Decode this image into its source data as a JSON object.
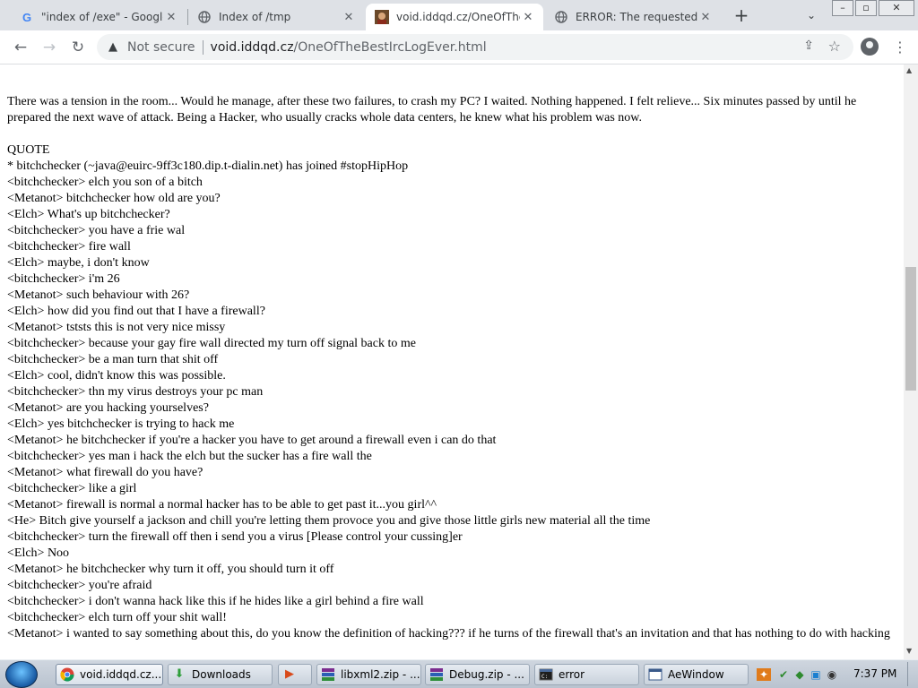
{
  "browser": {
    "tabs": [
      {
        "title": "\"index of /exe\" - Google",
        "icon": "google-g-icon",
        "active": false
      },
      {
        "title": "Index of /tmp",
        "icon": "globe-icon",
        "active": false
      },
      {
        "title": "void.iddqd.cz/OneOfTheB",
        "icon": "site-favicon",
        "active": true
      },
      {
        "title": "ERROR: The requested UR",
        "icon": "globe-icon",
        "active": false
      }
    ],
    "new_tab": "+",
    "tab_menu": "⌄",
    "window_controls": {
      "minimize": "–",
      "maximize": "▫",
      "close": "✕"
    },
    "address": {
      "security": "Not secure",
      "host": "void.iddqd.cz",
      "path": "/OneOfTheBestIrcLogEver.html"
    }
  },
  "page": {
    "intro": "There was a tension in the room... Would he manage, after these two failures, to crash my PC? I waited. Nothing happened. I felt relieve... Six minutes passed by until he prepared the next wave of attack. Being a Hacker, who usually cracks whole data centers, he knew what his problem was now.",
    "quote_label": "QUOTE",
    "chat": [
      "* bitchchecker (~java@euirc-9ff3c180.dip.t-dialin.net) has joined #stopHipHop",
      "<bitchchecker> elch you son of a bitch",
      "<Metanot> bitchchecker how old are you?",
      "<Elch> What's up bitchchecker?",
      "<bitchchecker> you have a frie wal",
      "<bitchchecker> fire wall",
      "<Elch> maybe, i don't know",
      "<bitchchecker> i'm 26",
      "<Metanot> such behaviour with 26?",
      "<Elch> how did you find out that I have a firewall?",
      "<Metanot> tststs this is not very nice missy",
      "<bitchchecker> because your gay fire wall directed my turn off signal back to me",
      "<bitchchecker> be a man turn that shit off",
      "<Elch> cool, didn't know this was possible.",
      "<bitchchecker> thn my virus destroys your pc man",
      "<Metanot> are you hacking yourselves?",
      "<Elch> yes bitchchecker is trying to hack me",
      "<Metanot> he bitchchecker if you're a hacker you have to get around a firewall even i can do that",
      "<bitchchecker> yes man i hack the elch but the sucker has a fire wall the",
      "<Metanot> what firewall do you have?",
      "<bitchchecker> like a girl",
      "<Metanot> firewall is normal a normal hacker has to be able to get past it...you girl^^",
      "<He> Bitch give yourself a jackson and chill you're letting them provoce you and give those little girls new material all the time",
      "<bitchchecker> turn the firewall off then i send you a virus [Please control your cussing]er",
      "<Elch> Noo",
      "<Metanot> he bitchchecker why turn it off, you should turn it off",
      "<bitchchecker> you're afraid",
      "<bitchchecker> i don't wanna hack like this if he hides like a girl behind a fire wall",
      "<bitchchecker> elch turn off your shit wall!",
      "<Metanot> i wanted to say something about this, do you know the definition of hacking??? if he turns of the firewall that's an invitation and that has nothing to do with hacking"
    ]
  },
  "taskbar": {
    "items": [
      {
        "label": "void.iddqd.cz...",
        "icon": "chrome-icon",
        "active": true
      },
      {
        "label": "Downloads",
        "icon": "downloads-folder-icon",
        "active": false
      },
      {
        "label": "",
        "icon": "media-player-icon",
        "active": false
      },
      {
        "label": "libxml2.zip - ...",
        "icon": "winrar-icon",
        "active": false
      },
      {
        "label": "Debug.zip - ...",
        "icon": "winrar-icon",
        "active": false
      },
      {
        "label": "error",
        "icon": "console-icon",
        "active": false
      },
      {
        "label": "AeWindow",
        "icon": "app-window-icon",
        "active": false
      }
    ],
    "clock": "7:37 PM"
  }
}
